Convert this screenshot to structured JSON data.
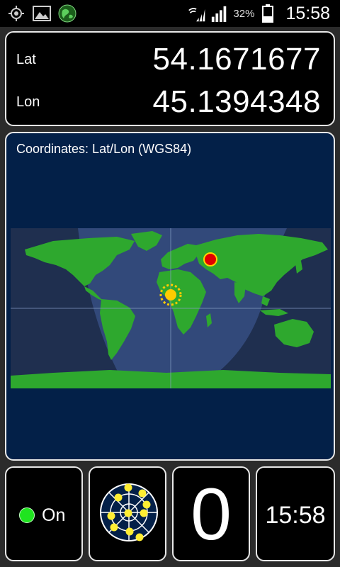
{
  "status_bar": {
    "left_icons": [
      "gps-target-icon",
      "gallery-icon",
      "app-globe-icon"
    ],
    "right_icons": [
      "wifi-icon",
      "signal-icon",
      "signal-icon-2",
      "battery-icon"
    ],
    "battery_percent": "32%",
    "time": "15:58"
  },
  "coordinates": {
    "lat_label": "Lat",
    "lat_value": "54.1671677",
    "lon_label": "Lon",
    "lon_value": "45.1394348"
  },
  "map": {
    "title": "Coordinates: Lat/Lon (WGS84)",
    "icons": [
      "location-marker-icon",
      "sun-icon"
    ],
    "colors": {
      "background": "#032048",
      "land": "#2ea82e",
      "marker": "#e00000",
      "sun": "#ffcc00"
    }
  },
  "tiles": {
    "status_label": "On",
    "status_color": "#1fe41f",
    "satellite_icon": "sky-plot-icon",
    "satellite_count": "0",
    "time": "15:58"
  }
}
